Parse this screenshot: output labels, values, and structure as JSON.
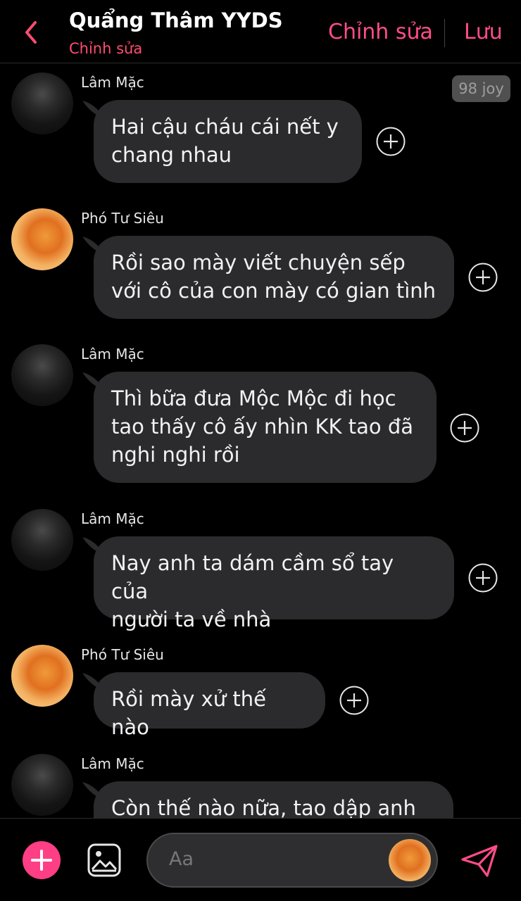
{
  "header": {
    "title": "Quẩng Thâm YYDS",
    "subtitle": "Chỉnh sửa",
    "edit_label": "Chỉnh sửa",
    "save_label": "Lưu"
  },
  "badge": "98 joy",
  "messages": [
    {
      "sender": "Lâm Mặc",
      "lines": [
        "Hai cậu cháu cái nết y",
        "chang nhau"
      ]
    },
    {
      "sender": "Phó Tư Siêu",
      "lines": [
        "Rồi sao mày viết chuyện sếp",
        "với cô của con mày có gian tình"
      ]
    },
    {
      "sender": "Lâm Mặc",
      "lines": [
        "Thì bữa đưa Mộc Mộc đi học",
        "tao thấy cô ấy nhìn KK tao đã",
        "nghi nghi rồi"
      ]
    },
    {
      "sender": "Lâm Mặc",
      "lines": [
        "Nay anh ta dám cầm sổ tay của",
        "người ta về nhà"
      ]
    },
    {
      "sender": "Phó Tư Siêu",
      "lines": [
        "Rồi mày xử thế nào"
      ]
    },
    {
      "sender": "Lâm Mặc",
      "lines": [
        "Còn thế nào nữa, tao dập anh"
      ]
    }
  ],
  "composer": {
    "placeholder": "Aa"
  },
  "icons": {
    "back": "chevron-left-icon",
    "plus": "plus-circle-icon",
    "image": "image-icon",
    "send": "send-icon"
  },
  "colors": {
    "accent": "#ff4d88",
    "bubble": "#2b2b2d",
    "background": "#000000"
  }
}
